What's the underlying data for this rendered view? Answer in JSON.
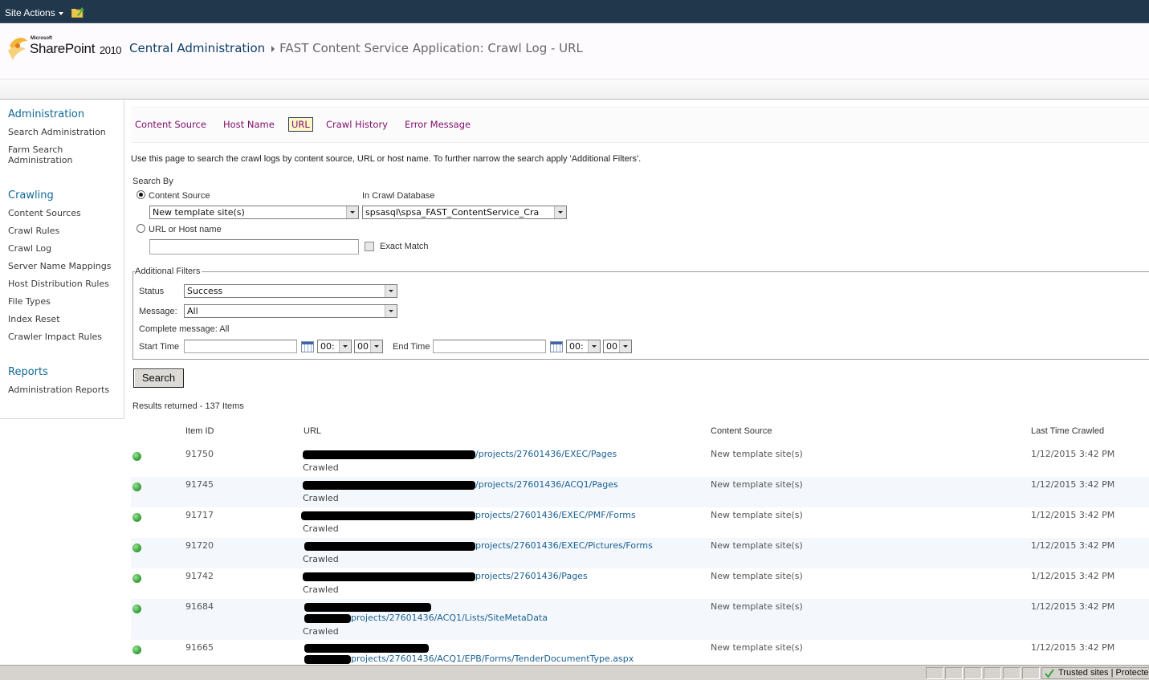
{
  "ribbon": {
    "site_actions_label": "Site Actions",
    "nav_up_icon": "navigate-up-folder-icon"
  },
  "header": {
    "logo_microsoft": "Microsoft",
    "logo_product": "SharePoint",
    "logo_year": "2010",
    "breadcrumb_root": "Central Administration",
    "breadcrumb_current": "FAST Content Service Application: Crawl Log - URL"
  },
  "quicklaunch": {
    "sections": [
      {
        "heading": "Administration",
        "items": [
          "Search Administration",
          "Farm Search Administration"
        ]
      },
      {
        "heading": "Crawling",
        "items": [
          "Content Sources",
          "Crawl Rules",
          "Crawl Log",
          "Server Name Mappings",
          "Host Distribution Rules",
          "File Types",
          "Index Reset",
          "Crawler Impact Rules"
        ]
      },
      {
        "heading": "Reports",
        "items": [
          "Administration Reports"
        ]
      }
    ]
  },
  "tabs": [
    {
      "label": "Content Source",
      "selected": false
    },
    {
      "label": "Host Name",
      "selected": false
    },
    {
      "label": "URL",
      "selected": true
    },
    {
      "label": "Crawl History",
      "selected": false
    },
    {
      "label": "Error Message",
      "selected": false
    }
  ],
  "page": {
    "description": "Use this page to search the crawl logs by content source, URL or host name. To further narrow the search apply 'Additional Filters'.",
    "search_by_label": "Search By",
    "radio_content_source": "Content Source",
    "radio_url_host": "URL or Host name",
    "content_source_value": "New template site(s)",
    "crawl_db_label": "In Crawl Database",
    "crawl_db_value": "spsasql\\spsa_FAST_ContentService_Cra",
    "url_input_value": "",
    "exact_match_label": "Exact Match",
    "exact_match_checked": false
  },
  "filters": {
    "legend": "Additional Filters",
    "status_label": "Status",
    "status_value": "Success",
    "message_label": "Message:",
    "message_value": "All",
    "complete_message": "Complete message: All",
    "start_time_label": "Start Time",
    "start_time_value": "",
    "start_hour": "00:",
    "start_minute": "00",
    "end_time_label": "End Time",
    "end_time_value": "",
    "end_hour": "00:",
    "end_minute": "00"
  },
  "search_button": "Search",
  "results_text": "Results returned - 137 Items",
  "grid": {
    "columns": [
      "Item ID",
      "URL",
      "Content Source",
      "Last Time Crawled"
    ],
    "rows": [
      {
        "id": "91750",
        "url": "/projects/27601436/EXEC/Pages",
        "status": "Crawled",
        "source": "New template site(s)",
        "time": "1/12/2015 3:42 PM"
      },
      {
        "id": "91745",
        "url": "/projects/27601436/ACQ1/Pages",
        "status": "Crawled",
        "source": "New template site(s)",
        "time": "1/12/2015 3:42 PM"
      },
      {
        "id": "91717",
        "url": "projects/27601436/EXEC/PMF/Forms",
        "status": "Crawled",
        "source": "New template site(s)",
        "time": "1/12/2015 3:42 PM"
      },
      {
        "id": "91720",
        "url": "projects/27601436/EXEC/Pictures/Forms",
        "status": "Crawled",
        "source": "New template site(s)",
        "time": "1/12/2015 3:42 PM"
      },
      {
        "id": "91742",
        "url": "projects/27601436/Pages",
        "status": "Crawled",
        "source": "New template site(s)",
        "time": "1/12/2015 3:42 PM"
      },
      {
        "id": "91684",
        "url": "projects/27601436/ACQ1/Lists/SiteMetaData",
        "status": "Crawled",
        "source": "New template site(s)",
        "time": "1/12/2015 3:42 PM"
      },
      {
        "id": "91665",
        "url": "projects/27601436/ACQ1/EPB/Forms/TenderDocumentType.aspx",
        "status": "",
        "source": "New template site(s)",
        "time": "1/12/2015 3:42 PM"
      }
    ]
  },
  "statusbar": {
    "zone_text": "Trusted sites | Protected Mode: Off"
  },
  "colors": {
    "ribbon_bg": "#21374c",
    "tab_link": "#7c0f6a",
    "quicklaunch_heading": "#0f6995",
    "url_link": "#1b6193",
    "status_success": "#3aa33a"
  }
}
